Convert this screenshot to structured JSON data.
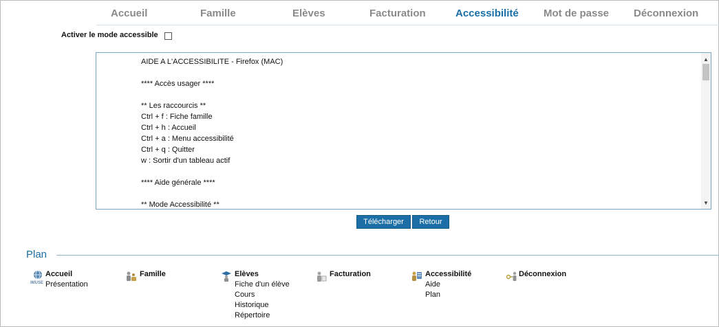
{
  "nav": {
    "items": [
      "Accueil",
      "Famille",
      "Elèves",
      "Facturation",
      "Accessibilité",
      "Mot de passe",
      "Déconnexion"
    ],
    "active": "Accessibilité"
  },
  "accessibility_toggle": {
    "label": "Activer le mode accessible",
    "checked": false
  },
  "help_text": {
    "lines": [
      "AIDE A L'ACCESSIBILITE - Firefox (MAC)",
      "",
      "**** Accès usager ****",
      "",
      "** Les raccourcis **",
      "Ctrl + f : Fiche famille",
      "Ctrl + h : Accueil",
      "Ctrl + a : Menu accessibilité",
      "Ctrl + q : Quitter",
      "w : Sortir d'un tableau actif",
      "",
      "**** Aide générale ****",
      "",
      "** Mode Accessibilité **"
    ]
  },
  "buttons": {
    "download": "Télécharger",
    "back": "Retour"
  },
  "plan": {
    "title": "Plan",
    "accueil": {
      "label": "Accueil",
      "icon_text": "IMUSE",
      "items": [
        "Présentation"
      ]
    },
    "famille": {
      "label": "Famille",
      "items": []
    },
    "eleves": {
      "label": "Elèves",
      "items": [
        "Fiche d'un élève",
        "Cours",
        "Historique",
        "Répertoire"
      ]
    },
    "facturation": {
      "label": "Facturation",
      "items": []
    },
    "accessibilite": {
      "label": "Accessibilité",
      "items": [
        "Aide",
        "Plan"
      ]
    },
    "deconnexion": {
      "label": "Déconnexion",
      "items": []
    }
  },
  "colors": {
    "accent": "#1a6ea6",
    "nav_inactive": "#8a8a8a",
    "button_bg": "#1c6fa6"
  }
}
